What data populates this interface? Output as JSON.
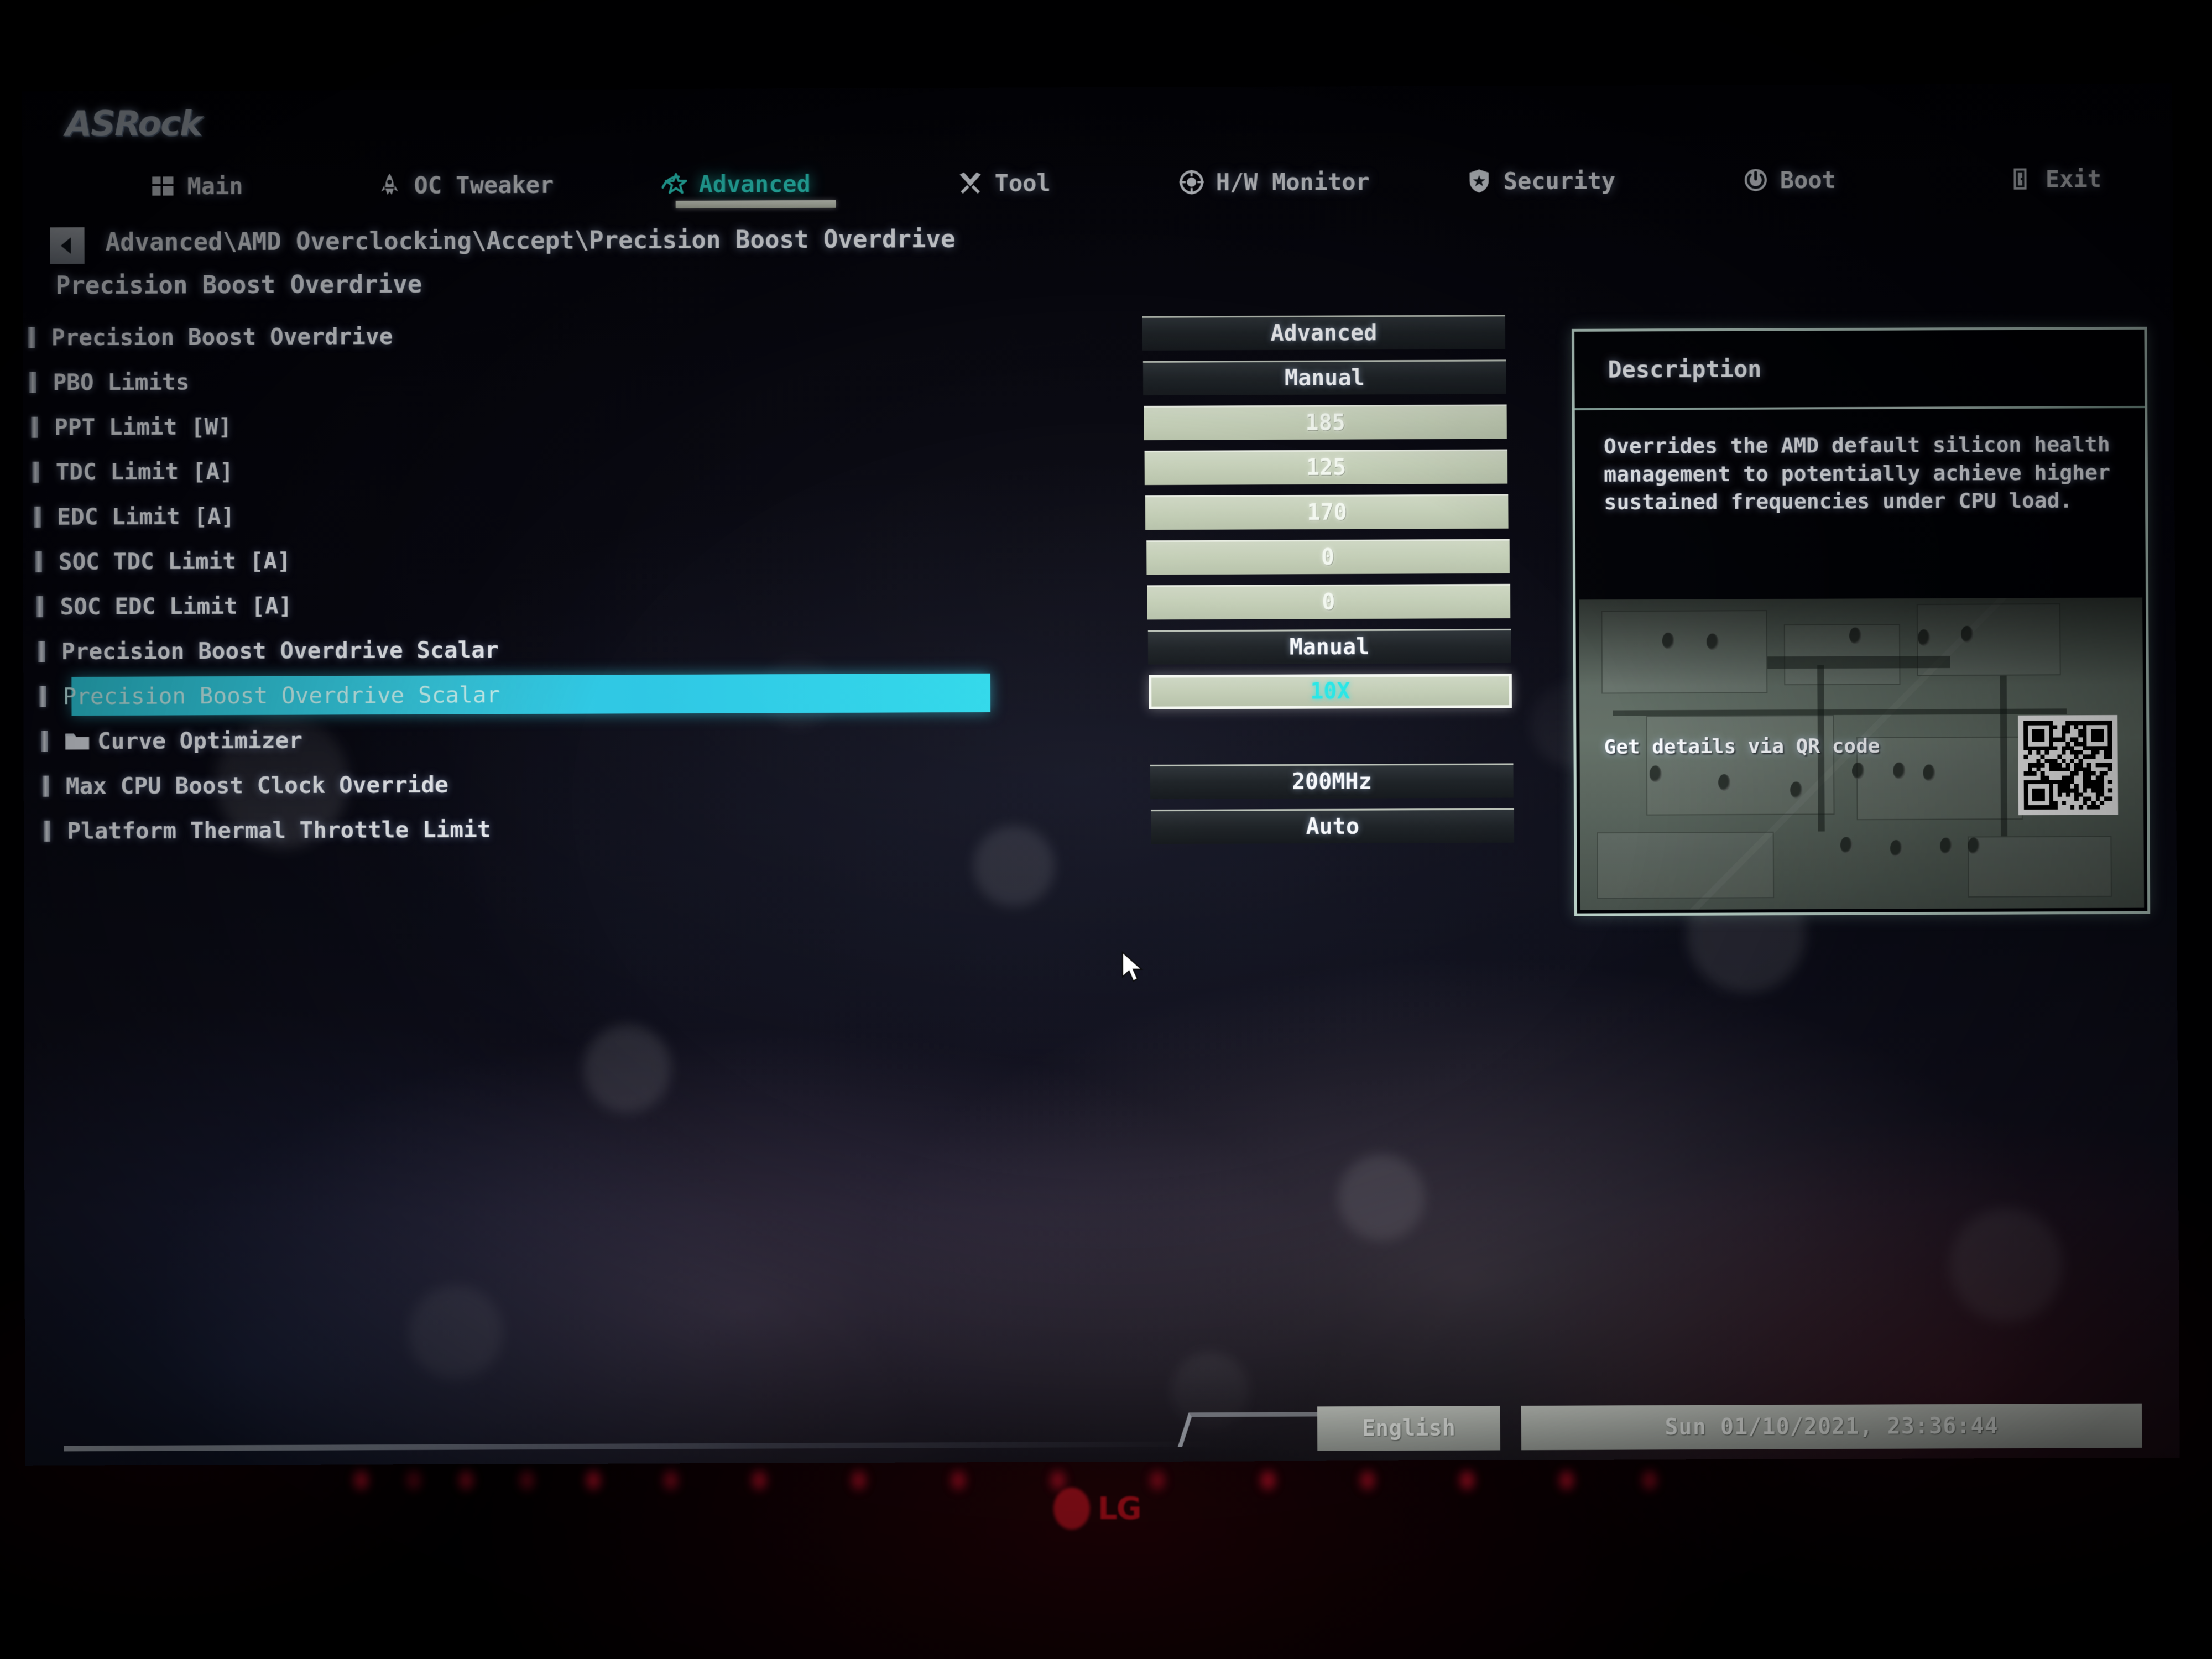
{
  "brand": "ASRock",
  "nav": {
    "items": [
      {
        "label": "Main",
        "icon": "grid-icon",
        "active": false
      },
      {
        "label": "OC Tweaker",
        "icon": "rocket-icon",
        "active": false
      },
      {
        "label": "Advanced",
        "icon": "star-icon",
        "active": true
      },
      {
        "label": "Tool",
        "icon": "tools-icon",
        "active": false
      },
      {
        "label": "H/W Monitor",
        "icon": "target-icon",
        "active": false
      },
      {
        "label": "Security",
        "icon": "shield-icon",
        "active": false
      },
      {
        "label": "Boot",
        "icon": "power-icon",
        "active": false
      },
      {
        "label": "Exit",
        "icon": "exit-icon",
        "active": false
      }
    ]
  },
  "breadcrumb": "Advanced\\AMD Overclocking\\Accept\\Precision Boost Overdrive",
  "page_title": "Precision Boost Overdrive",
  "settings": [
    {
      "label": "Precision Boost Overdrive",
      "value": "Advanced",
      "kind": "option",
      "folder": false,
      "selected": false,
      "focused": false
    },
    {
      "label": "PBO Limits",
      "value": "Manual",
      "kind": "option",
      "folder": false,
      "selected": false,
      "focused": false
    },
    {
      "label": "PPT Limit [W]",
      "value": "185",
      "kind": "number",
      "folder": false,
      "selected": false,
      "focused": false
    },
    {
      "label": "TDC Limit [A]",
      "value": "125",
      "kind": "number",
      "folder": false,
      "selected": false,
      "focused": false
    },
    {
      "label": "EDC Limit [A]",
      "value": "170",
      "kind": "number",
      "folder": false,
      "selected": false,
      "focused": false
    },
    {
      "label": "SOC TDC Limit [A]",
      "value": "0",
      "kind": "number",
      "folder": false,
      "selected": false,
      "focused": false
    },
    {
      "label": "SOC EDC Limit [A]",
      "value": "0",
      "kind": "number",
      "folder": false,
      "selected": false,
      "focused": false
    },
    {
      "label": "Precision Boost Overdrive Scalar",
      "value": "Manual",
      "kind": "option",
      "folder": false,
      "selected": false,
      "focused": false
    },
    {
      "label": "Precision Boost Overdrive Scalar",
      "value": "10X",
      "kind": "number",
      "folder": false,
      "selected": true,
      "focused": true
    },
    {
      "label": "Curve Optimizer",
      "value": "",
      "kind": "none",
      "folder": true,
      "selected": false,
      "focused": false
    },
    {
      "label": "Max CPU Boost Clock Override",
      "value": "200MHz",
      "kind": "option",
      "folder": false,
      "selected": false,
      "focused": false
    },
    {
      "label": "Platform Thermal Throttle Limit",
      "value": "Auto",
      "kind": "option",
      "folder": false,
      "selected": false,
      "focused": false
    }
  ],
  "description": {
    "title": "Description",
    "body": "Overrides the AMD default silicon health management to potentially achieve higher sustained frequencies under CPU load.",
    "qr_label": "Get details via QR code"
  },
  "footer": {
    "language": "English",
    "datetime": "Sun 01/10/2021, 23:36:44"
  },
  "monitor": {
    "vendor": "LG"
  },
  "colors": {
    "accent_cyan": "#2fe8d8",
    "highlight_bar": "#2bc6e4",
    "focus_text": "#25e6e6",
    "numeric_field": "#c3ceb6",
    "option_field": "#1b2024",
    "led_red": "#c4112a"
  }
}
